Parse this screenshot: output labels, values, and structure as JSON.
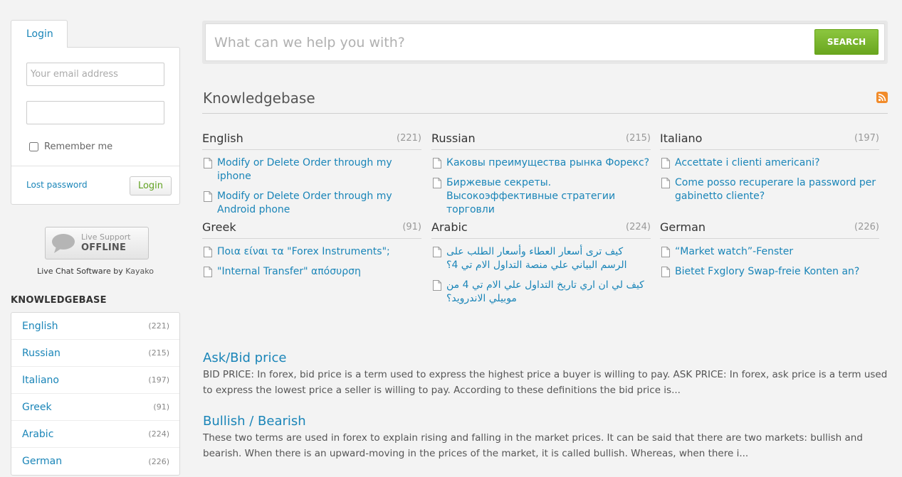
{
  "login": {
    "tab_label": "Login",
    "email_placeholder": "Your email address",
    "remember_label": "Remember me",
    "lost_password": "Lost password",
    "button_label": "Login"
  },
  "live_support": {
    "line1": "Live Support",
    "line2": "OFFLINE",
    "credit_text": "Live Chat Software by ",
    "credit_brand": "Kayako"
  },
  "sidebar_kb": {
    "heading": "KNOWLEDGEBASE",
    "items": [
      {
        "name": "English",
        "count": "(221)"
      },
      {
        "name": "Russian",
        "count": "(215)"
      },
      {
        "name": "Italiano",
        "count": "(197)"
      },
      {
        "name": "Greek",
        "count": "(91)"
      },
      {
        "name": "Arabic",
        "count": "(224)"
      },
      {
        "name": "German",
        "count": "(226)"
      }
    ]
  },
  "search": {
    "placeholder": "What can we help you with?",
    "button_label": "SEARCH"
  },
  "main": {
    "title": "Knowledgebase",
    "categories": [
      {
        "name": "English",
        "count": "(221)",
        "articles": [
          "Modify or Delete Order through my iphone",
          "Modify or Delete Order through my Android phone"
        ]
      },
      {
        "name": "Russian",
        "count": "(215)",
        "articles": [
          "Каковы преимущества рынка Форекс?",
          "Биржевые секреты. Высокоэффективные стратегии торговли"
        ]
      },
      {
        "name": "Italiano",
        "count": "(197)",
        "articles": [
          "Accettate i clienti americani?",
          "Come posso recuperare la password per gabinetto cliente?"
        ]
      },
      {
        "name": "Greek",
        "count": "(91)",
        "articles": [
          "Ποια είναι τα \"Forex Instruments\";",
          "\"Internal Transfer\" απόσυρση"
        ]
      },
      {
        "name": "Arabic",
        "count": "(224)",
        "articles": [
          "كيف ترى أسعار العطاء وأسعار الطلب على الرسم البياني علي منصة التداول الام تي 4؟",
          "كيف لي ان اري تاريخ التداول علي الام تي 4 من موبيلي الاندرويد؟"
        ]
      },
      {
        "name": "German",
        "count": "(226)",
        "articles": [
          "“Market watch”-Fenster",
          "Bietet Fxglory Swap-freie Konten an?"
        ]
      }
    ],
    "articles": [
      {
        "title": "Ask/Bid price",
        "excerpt": "BID PRICE: In forex, bid price is a term used to express the highest price a buyer is willing to pay. ASK PRICE: In forex, ask price is a term used to express the lowest price a seller is willing to pay. According to these definitions the bid price is..."
      },
      {
        "title": "Bullish / Bearish",
        "excerpt": "These two terms are used in forex to explain rising and falling in the market prices. It can be said that there are two markets: bullish and bearish. When there is an upward-moving in the prices of the market, it is called bullish. Whereas, when there i..."
      }
    ]
  },
  "colors": {
    "link": "#1a85b8",
    "search_button": "#7ab630",
    "rss": "#f18b2a"
  }
}
